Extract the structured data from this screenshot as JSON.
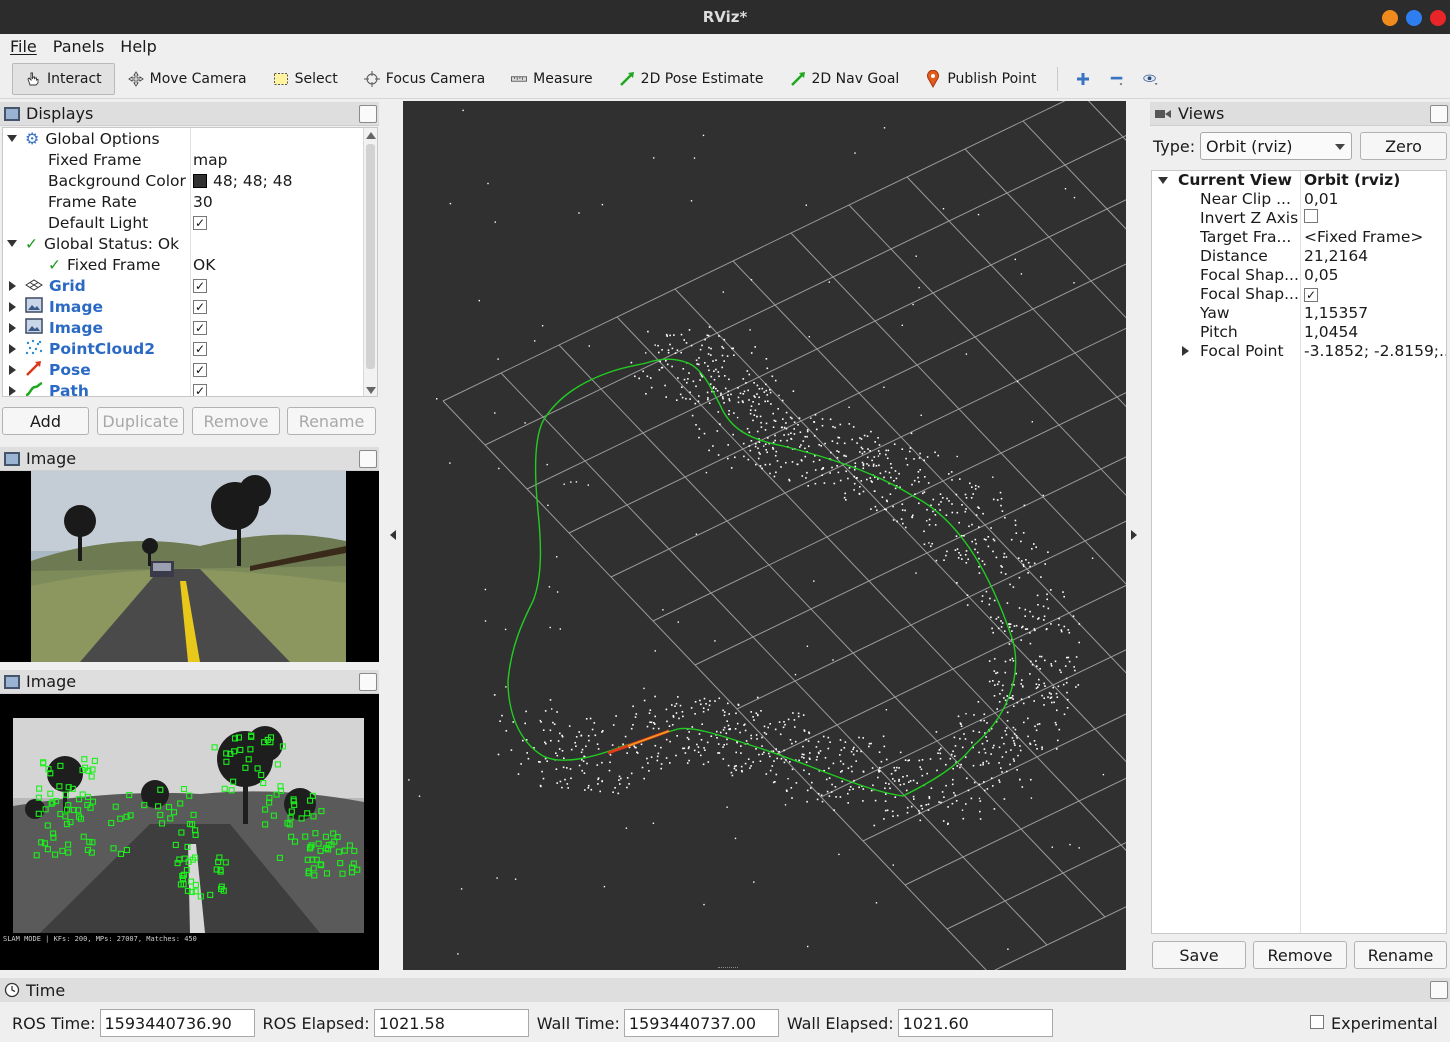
{
  "window": {
    "title": "RViz*"
  },
  "menu": {
    "file": "File",
    "panels": "Panels",
    "help": "Help"
  },
  "toolbar": {
    "interact": "Interact",
    "move_camera": "Move Camera",
    "select": "Select",
    "focus_camera": "Focus Camera",
    "measure": "Measure",
    "pose_estimate": "2D Pose Estimate",
    "nav_goal": "2D Nav Goal",
    "publish_point": "Publish Point"
  },
  "displays": {
    "title": "Displays",
    "global_options": "Global Options",
    "fixed_frame_label": "Fixed Frame",
    "fixed_frame_value": "map",
    "bg_color_label": "Background Color",
    "bg_color_value": "48; 48; 48",
    "frame_rate_label": "Frame Rate",
    "frame_rate_value": "30",
    "default_light_label": "Default Light",
    "global_status": "Global Status: Ok",
    "status_fixed_frame": "Fixed Frame",
    "status_fixed_frame_value": "OK",
    "items": [
      "Grid",
      "Image",
      "Image",
      "PointCloud2",
      "Pose",
      "Path"
    ],
    "buttons": {
      "add": "Add",
      "duplicate": "Duplicate",
      "remove": "Remove",
      "rename": "Rename"
    }
  },
  "image_panel_1": {
    "title": "Image"
  },
  "image_panel_2": {
    "title": "Image",
    "overlay": "SLAM MODE | KFs: 200, MPs: 27007, Matches: 450"
  },
  "views": {
    "title": "Views",
    "type_label": "Type:",
    "type_value": "Orbit (rviz)",
    "zero": "Zero",
    "current_view": "Current View",
    "current_view_value": "Orbit (rviz)",
    "props": [
      {
        "name": "Near Clip ...",
        "value": "0,01"
      },
      {
        "name": "Invert Z Axis",
        "value": ""
      },
      {
        "name": "Target Fra...",
        "value": "<Fixed Frame>"
      },
      {
        "name": "Distance",
        "value": "21,2164"
      },
      {
        "name": "Focal Shap...",
        "value": "0,05"
      },
      {
        "name": "Focal Shap...",
        "value": ""
      },
      {
        "name": "Yaw",
        "value": "1,15357"
      },
      {
        "name": "Pitch",
        "value": "1,0454"
      },
      {
        "name": "Focal Point",
        "value": "-3.1852; -2.8159;..."
      }
    ],
    "buttons": {
      "save": "Save",
      "remove": "Remove",
      "rename": "Rename"
    }
  },
  "time": {
    "title": "Time",
    "ros_time_label": "ROS Time:",
    "ros_time": "1593440736.90",
    "ros_elapsed_label": "ROS Elapsed:",
    "ros_elapsed": "1021.58",
    "wall_time_label": "Wall Time:",
    "wall_time": "1593440737.00",
    "wall_elapsed_label": "Wall Elapsed:",
    "wall_elapsed": "1021.60",
    "experimental": "Experimental"
  },
  "colors": {
    "viewport_bg": "#303030",
    "path": "#22cc22",
    "pose": "#e03a1a",
    "display_name": "#2a6ac4"
  }
}
